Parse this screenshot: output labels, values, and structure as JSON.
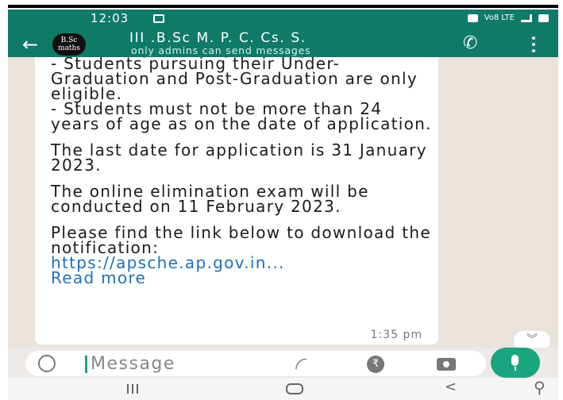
{
  "status_bar": {
    "time": "12:03",
    "carrier": "Vo8 LTE"
  },
  "chat_header": {
    "avatar_text": "B.Sc maths",
    "title": "III .B.Sc M. P. C. Cs. S.",
    "subtitle": "only admins can send messages"
  },
  "message": {
    "paragraphs": [
      "academic years only are eligible.\n- Students pursuing their Under-Graduation and Post-Graduation are only eligible.\n- Students must not be more than 24 years of age as on the date of application.",
      "The last date for application is 31 January 2023.",
      "The online elimination exam will be conducted on 11 February 2023.",
      "Please find the link below to download the notification:"
    ],
    "link": "https://apsche.ap.gov.in...",
    "read_more": "Read more",
    "time": "1:35 pm"
  },
  "input": {
    "placeholder": "Message"
  },
  "colors": {
    "header": "#0f7a68",
    "accent": "#1aa57e",
    "link": "#1f6fb8"
  },
  "icons": [
    "back-arrow-icon",
    "call-add-icon",
    "menu-icon",
    "emoji-icon",
    "attach-icon",
    "payment-icon",
    "camera-icon",
    "mic-icon",
    "scroll-down-icon"
  ]
}
